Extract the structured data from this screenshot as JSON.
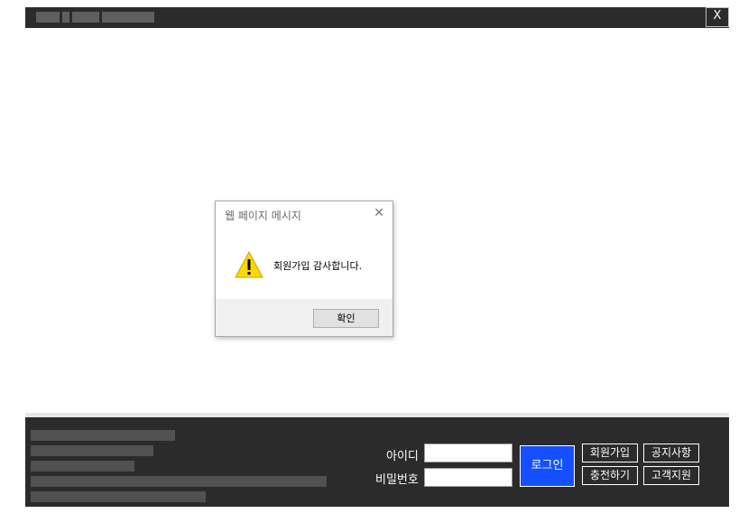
{
  "window": {
    "close_label": "X"
  },
  "dialog": {
    "title": "웹 페이지 메시지",
    "close_label": "✕",
    "message": "회원가입 감사합니다.",
    "ok_label": "확인",
    "icon": "warning-icon"
  },
  "login": {
    "id_label": "아이디",
    "id_value": "",
    "password_label": "비밀번호",
    "password_value": "",
    "login_label": "로그인",
    "signup_label": "회원가입",
    "notice_label": "공지사항",
    "charge_label": "충전하기",
    "support_label": "고객지원"
  },
  "colors": {
    "titlebar": "#2b2b2b",
    "footer": "#2b2b2b",
    "login_button": "#1450ff",
    "warning": "#ffd700"
  }
}
